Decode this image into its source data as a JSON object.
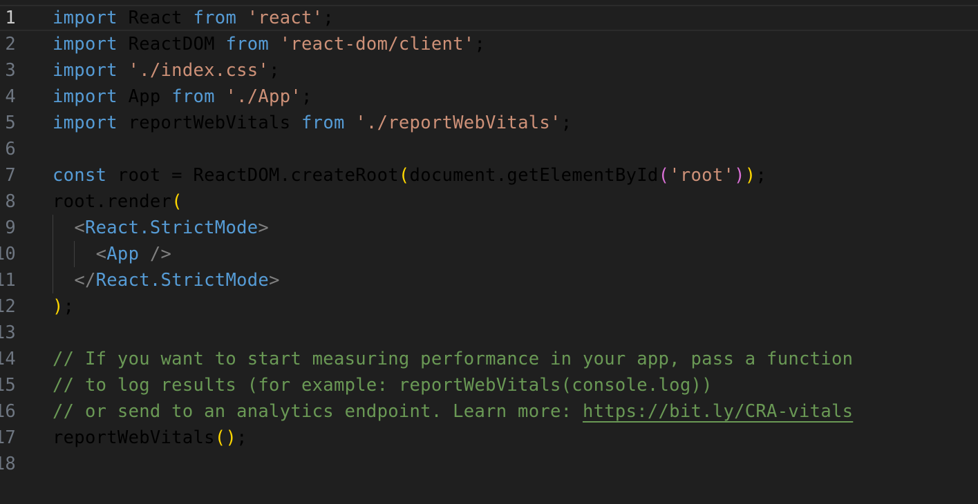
{
  "editor": {
    "language": "javascript",
    "current_line": 1,
    "lines": [
      {
        "n": "1",
        "tokens": [
          {
            "t": "import",
            "c": "kw"
          },
          {
            "t": " React ",
            "c": "plain"
          },
          {
            "t": "from",
            "c": "kw"
          },
          {
            "t": " ",
            "c": "plain"
          },
          {
            "t": "'react'",
            "c": "str"
          },
          {
            "t": ";",
            "c": "plain"
          }
        ]
      },
      {
        "n": "2",
        "tokens": [
          {
            "t": "import",
            "c": "kw"
          },
          {
            "t": " ReactDOM ",
            "c": "plain"
          },
          {
            "t": "from",
            "c": "kw"
          },
          {
            "t": " ",
            "c": "plain"
          },
          {
            "t": "'react-dom/client'",
            "c": "str"
          },
          {
            "t": ";",
            "c": "plain"
          }
        ]
      },
      {
        "n": "3",
        "tokens": [
          {
            "t": "import",
            "c": "kw"
          },
          {
            "t": " ",
            "c": "plain"
          },
          {
            "t": "'./index.css'",
            "c": "str"
          },
          {
            "t": ";",
            "c": "plain"
          }
        ]
      },
      {
        "n": "4",
        "tokens": [
          {
            "t": "import",
            "c": "kw"
          },
          {
            "t": " App ",
            "c": "plain"
          },
          {
            "t": "from",
            "c": "kw"
          },
          {
            "t": " ",
            "c": "plain"
          },
          {
            "t": "'./App'",
            "c": "str"
          },
          {
            "t": ";",
            "c": "plain"
          }
        ]
      },
      {
        "n": "5",
        "tokens": [
          {
            "t": "import",
            "c": "kw"
          },
          {
            "t": " reportWebVitals ",
            "c": "plain"
          },
          {
            "t": "from",
            "c": "kw"
          },
          {
            "t": " ",
            "c": "plain"
          },
          {
            "t": "'./reportWebVitals'",
            "c": "str"
          },
          {
            "t": ";",
            "c": "plain"
          }
        ]
      },
      {
        "n": "6",
        "tokens": []
      },
      {
        "n": "7",
        "tokens": [
          {
            "t": "const",
            "c": "kw"
          },
          {
            "t": " root = ReactDOM.createRoot",
            "c": "plain"
          },
          {
            "t": "(",
            "c": "b1"
          },
          {
            "t": "document.getElementById",
            "c": "plain"
          },
          {
            "t": "(",
            "c": "b2"
          },
          {
            "t": "'root'",
            "c": "str"
          },
          {
            "t": ")",
            "c": "b2"
          },
          {
            "t": ")",
            "c": "b1"
          },
          {
            "t": ";",
            "c": "plain"
          }
        ]
      },
      {
        "n": "8",
        "tokens": [
          {
            "t": "root.render",
            "c": "plain"
          },
          {
            "t": "(",
            "c": "b1"
          }
        ]
      },
      {
        "n": "9",
        "tokens": [
          {
            "t": "  ",
            "c": "plain"
          },
          {
            "t": "<",
            "c": "angle"
          },
          {
            "t": "React.StrictMode",
            "c": "tagname"
          },
          {
            "t": ">",
            "c": "angle"
          }
        ]
      },
      {
        "n": "10",
        "tokens": [
          {
            "t": "    ",
            "c": "plain"
          },
          {
            "t": "<",
            "c": "angle"
          },
          {
            "t": "App",
            "c": "tagname"
          },
          {
            "t": " />",
            "c": "angle"
          }
        ]
      },
      {
        "n": "11",
        "tokens": [
          {
            "t": "  ",
            "c": "plain"
          },
          {
            "t": "</",
            "c": "angle"
          },
          {
            "t": "React.StrictMode",
            "c": "tagname"
          },
          {
            "t": ">",
            "c": "angle"
          }
        ]
      },
      {
        "n": "12",
        "tokens": [
          {
            "t": ")",
            "c": "b1"
          },
          {
            "t": ";",
            "c": "plain"
          }
        ]
      },
      {
        "n": "13",
        "tokens": []
      },
      {
        "n": "14",
        "tokens": [
          {
            "t": "// If you want to start measuring performance in your app, pass a function",
            "c": "cmt"
          }
        ]
      },
      {
        "n": "15",
        "tokens": [
          {
            "t": "// to log results (for example: reportWebVitals(console.log))",
            "c": "cmt"
          }
        ]
      },
      {
        "n": "16",
        "tokens": [
          {
            "t": "// or send to an analytics endpoint. Learn more: ",
            "c": "cmt"
          },
          {
            "t": "https://bit.ly/CRA-vitals",
            "c": "link"
          }
        ]
      },
      {
        "n": "17",
        "tokens": [
          {
            "t": "reportWebVitals",
            "c": "plain"
          },
          {
            "t": "()",
            "c": "b1"
          },
          {
            "t": ";",
            "c": "plain"
          }
        ]
      },
      {
        "n": "18",
        "tokens": []
      }
    ]
  }
}
